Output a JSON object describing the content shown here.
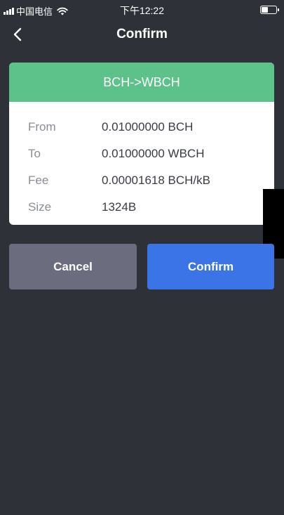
{
  "status_bar": {
    "carrier": "中国电信",
    "time": "下午12:22"
  },
  "nav": {
    "title": "Confirm",
    "back_icon": "chevron-left-icon"
  },
  "card": {
    "header": "BCH->WBCH",
    "header_color": "#5cc28a",
    "rows": [
      {
        "label": "From",
        "value": "0.01000000 BCH"
      },
      {
        "label": "To",
        "value": "0.01000000 WBCH"
      },
      {
        "label": "Fee",
        "value": "0.00001618 BCH/kB"
      },
      {
        "label": "Size",
        "value": "1324B"
      }
    ]
  },
  "buttons": {
    "cancel_label": "Cancel",
    "confirm_label": "Confirm",
    "cancel_color": "#6b6d7e",
    "confirm_color": "#3b74e6"
  },
  "colors": {
    "background": "#2f3139"
  }
}
